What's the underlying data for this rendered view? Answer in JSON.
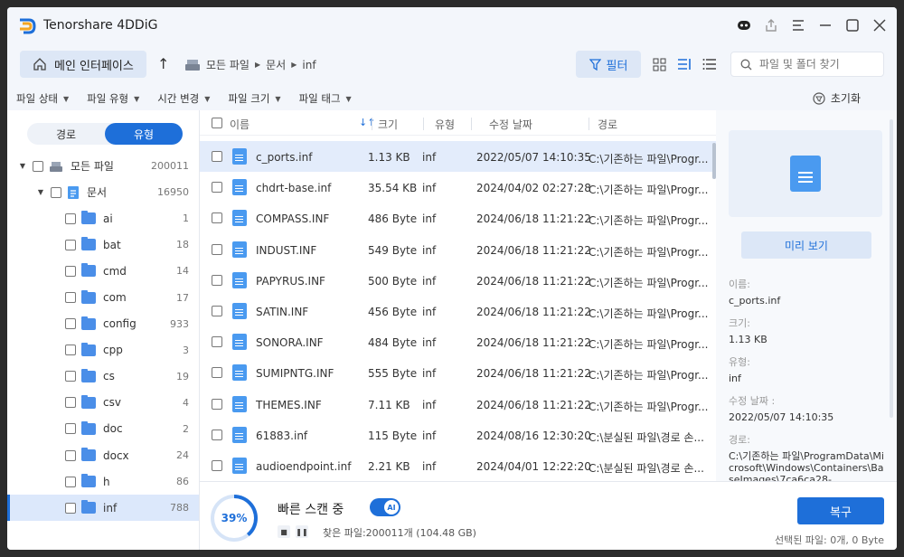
{
  "app": {
    "title": "Tenorshare 4DDiG"
  },
  "nav": {
    "home_label": "메인 인터페이스",
    "breadcrumbs": [
      "모든 파일",
      "문서",
      "inf"
    ],
    "filter_label": "필터",
    "search_placeholder": "파일 및 폴더 찾기"
  },
  "filters": {
    "items": [
      "파일 상태",
      "파일 유형",
      "시간 변경",
      "파일 크기",
      "파일 태그"
    ],
    "reset_label": "초기화"
  },
  "sidebar": {
    "tabs": [
      "경로",
      "유형"
    ],
    "active_tab": "유형",
    "tree": [
      {
        "label": "모든 파일",
        "count": "200011",
        "level": 0,
        "expanded": true,
        "icon": "drive-icon"
      },
      {
        "label": "문서",
        "count": "16950",
        "level": 1,
        "expanded": true,
        "icon": "document-icon"
      },
      {
        "label": "ai",
        "count": "1",
        "level": 2
      },
      {
        "label": "bat",
        "count": "18",
        "level": 2
      },
      {
        "label": "cmd",
        "count": "14",
        "level": 2
      },
      {
        "label": "com",
        "count": "17",
        "level": 2
      },
      {
        "label": "config",
        "count": "933",
        "level": 2
      },
      {
        "label": "cpp",
        "count": "3",
        "level": 2
      },
      {
        "label": "cs",
        "count": "19",
        "level": 2
      },
      {
        "label": "csv",
        "count": "4",
        "level": 2
      },
      {
        "label": "doc",
        "count": "2",
        "level": 2
      },
      {
        "label": "docx",
        "count": "24",
        "level": 2
      },
      {
        "label": "h",
        "count": "86",
        "level": 2
      },
      {
        "label": "inf",
        "count": "788",
        "level": 2,
        "selected": true
      }
    ]
  },
  "table": {
    "columns": [
      "이름",
      "크기",
      "유형",
      "수정 날짜",
      "경로"
    ],
    "rows": [
      {
        "name": "c_ports.inf",
        "size": "1.13 KB",
        "type": "inf",
        "date": "2022/05/07 14:10:35",
        "path": "C:\\기존하는 파일\\Progr...",
        "selected": true
      },
      {
        "name": "chdrt-base.inf",
        "size": "35.54 KB",
        "type": "inf",
        "date": "2024/04/02 02:27:28",
        "path": "C:\\기존하는 파일\\Progr..."
      },
      {
        "name": "COMPASS.INF",
        "size": "486 Byte",
        "type": "inf",
        "date": "2024/06/18 11:21:22",
        "path": "C:\\기존하는 파일\\Progr..."
      },
      {
        "name": "INDUST.INF",
        "size": "549 Byte",
        "type": "inf",
        "date": "2024/06/18 11:21:22",
        "path": "C:\\기존하는 파일\\Progr..."
      },
      {
        "name": "PAPYRUS.INF",
        "size": "500 Byte",
        "type": "inf",
        "date": "2024/06/18 11:21:22",
        "path": "C:\\기존하는 파일\\Progr..."
      },
      {
        "name": "SATIN.INF",
        "size": "456 Byte",
        "type": "inf",
        "date": "2024/06/18 11:21:22",
        "path": "C:\\기존하는 파일\\Progr..."
      },
      {
        "name": "SONORA.INF",
        "size": "484 Byte",
        "type": "inf",
        "date": "2024/06/18 11:21:22",
        "path": "C:\\기존하는 파일\\Progr..."
      },
      {
        "name": "SUMIPNTG.INF",
        "size": "555 Byte",
        "type": "inf",
        "date": "2024/06/18 11:21:22",
        "path": "C:\\기존하는 파일\\Progr..."
      },
      {
        "name": "THEMES.INF",
        "size": "7.11 KB",
        "type": "inf",
        "date": "2024/06/18 11:21:22",
        "path": "C:\\기존하는 파일\\Progr..."
      },
      {
        "name": "61883.inf",
        "size": "115 Byte",
        "type": "inf",
        "date": "2024/08/16 12:30:20",
        "path": "C:\\분실된 파일\\경로 손..."
      },
      {
        "name": "audioendpoint.inf",
        "size": "2.21 KB",
        "type": "inf",
        "date": "2024/04/01 12:22:20",
        "path": "C:\\분실된 파일\\경로 손..."
      }
    ]
  },
  "preview": {
    "button_label": "미리 보기",
    "name_label": "이름:",
    "name_value": "c_ports.inf",
    "size_label": "크기:",
    "size_value": "1.13 KB",
    "type_label": "유형:",
    "type_value": "inf",
    "date_label": "수정 날짜 :",
    "date_value": "2022/05/07 14:10:35",
    "path_label": "경로:",
    "path_value": "C:\\기존하는 파일\\ProgramData\\Microsoft\\Windows\\Containers\\BaseImages\\7ca6ca28-"
  },
  "scan": {
    "percent": "39%",
    "progress_fraction": 0.39,
    "title": "빠른 스캔 중",
    "ai_toggle_on": true,
    "found_text": "찾은 파일:200011개 (104.48 GB)"
  },
  "actions": {
    "recover_label": "복구",
    "selected_info": "선택된 파일: 0개, 0 Byte"
  },
  "colors": {
    "accent": "#1e6fd9",
    "selected_row": "#e3ecfb",
    "file_icon": "#4a9af0"
  }
}
